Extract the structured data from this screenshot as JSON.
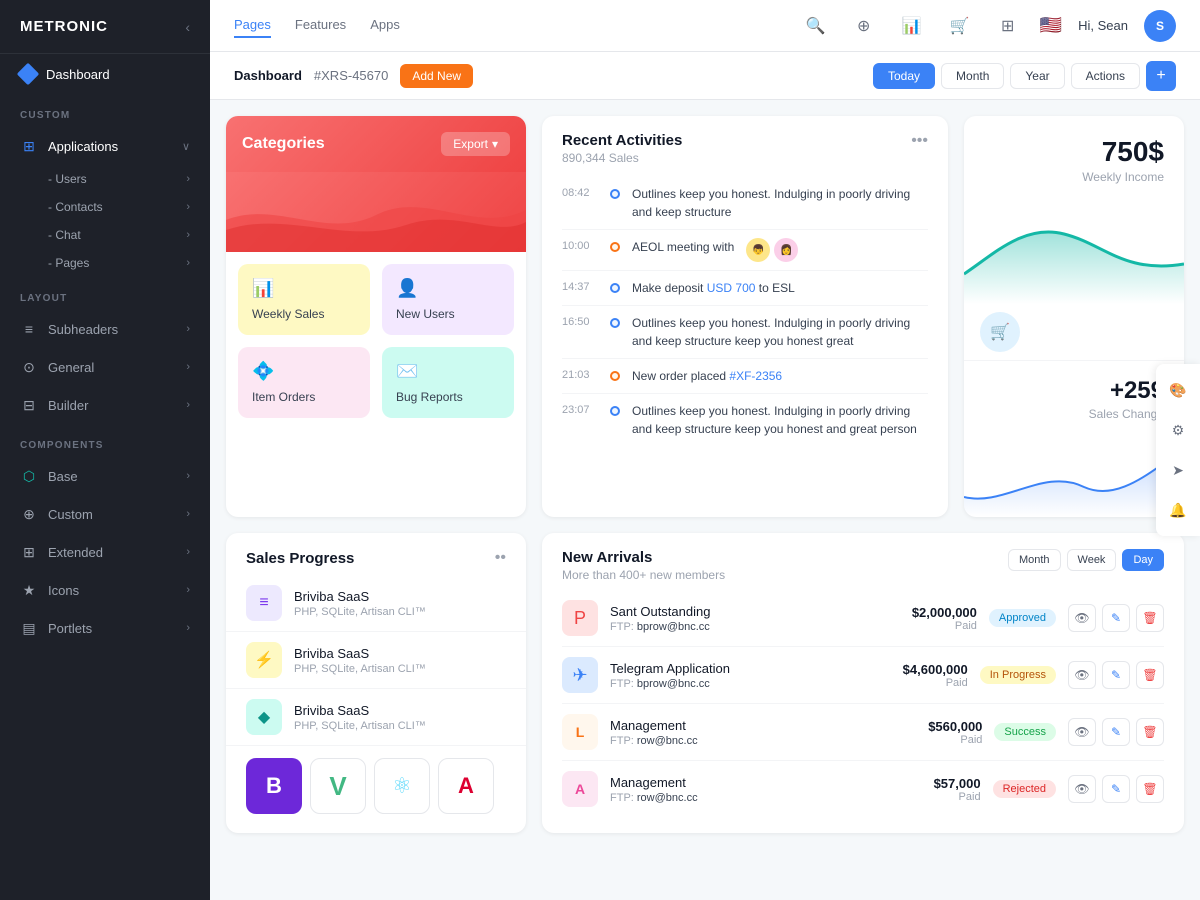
{
  "app": {
    "name": "METRONIC"
  },
  "topNav": {
    "tabs": [
      "Pages",
      "Features",
      "Apps"
    ],
    "activeTab": "Pages",
    "user": {
      "greeting": "Hi, Sean",
      "initials": "S"
    }
  },
  "breadcrumb": {
    "main": "Dashboard",
    "id": "#XRS-45670",
    "addNew": "Add New",
    "buttons": [
      "Today",
      "Month",
      "Year",
      "Actions"
    ]
  },
  "sidebar": {
    "logo": "METRONIC",
    "dashboard": "Dashboard",
    "sections": {
      "custom": "CUSTOM",
      "layout": "LAYOUT",
      "components": "COMPONENTS"
    },
    "customItems": [
      "Applications",
      "Users",
      "Contacts",
      "Chat",
      "Pages"
    ],
    "layoutItems": [
      "Subheaders",
      "General",
      "Builder"
    ],
    "componentItems": [
      "Base",
      "Custom",
      "Extended",
      "Icons",
      "Portlets"
    ]
  },
  "categories": {
    "title": "Categories",
    "exportLabel": "Export",
    "items": [
      {
        "label": "Weekly Sales",
        "icon": "📊",
        "color": "yellow"
      },
      {
        "label": "New Users",
        "icon": "👤+",
        "color": "purple"
      },
      {
        "label": "Item Orders",
        "icon": "💎",
        "color": "pink"
      },
      {
        "label": "Bug Reports",
        "icon": "✉️",
        "color": "teal"
      }
    ]
  },
  "recentActivities": {
    "title": "Recent Activities",
    "subtitle": "890,344 Sales",
    "items": [
      {
        "time": "08:42",
        "text": "Outlines keep you honest. Indulging in poorly driving and keep structure",
        "dotColor": "blue"
      },
      {
        "time": "10:00",
        "text": "AEOL meeting with",
        "dotColor": "orange",
        "hasAvatars": true
      },
      {
        "time": "14:37",
        "text": "Make deposit USD 700 to ESL",
        "dotColor": "blue",
        "highlight": "USD 700"
      },
      {
        "time": "16:50",
        "text": "Outlines keep you honest. Indulging in poorly driving and keep structure keep you honest great",
        "dotColor": "blue"
      },
      {
        "time": "21:03",
        "text": "New order placed #XF-2356",
        "dotColor": "orange",
        "highlight": "#XF-2356"
      },
      {
        "time": "23:07",
        "text": "Outlines keep you honest. Indulging in poorly driving and keep structure keep you honest and great person",
        "dotColor": "blue"
      }
    ]
  },
  "weeklyIncome": {
    "amount": "750$",
    "label": "Weekly Income",
    "change": "+259",
    "changeLabel": "Sales Change"
  },
  "salesProgress": {
    "title": "Sales Progress",
    "items": [
      {
        "name": "Briviba SaaS",
        "desc": "PHP, SQLite, Artisan CLI™",
        "iconColor": "purple",
        "icon": "≡"
      },
      {
        "name": "Briviba SaaS",
        "desc": "PHP, SQLite, Artisan CLI™",
        "iconColor": "yellow",
        "icon": "⚡"
      },
      {
        "name": "Briviba SaaS",
        "desc": "PHP, SQLite, Artisan CLI™",
        "iconColor": "teal",
        "icon": "◆"
      }
    ]
  },
  "newArrivals": {
    "title": "New Arrivals",
    "subtitle": "More than 400+ new members",
    "tabs": [
      "Month",
      "Week",
      "Day"
    ],
    "activeTab": "Day",
    "items": [
      {
        "name": "Sant Outstanding",
        "ftp": "bprow@bnc.cc",
        "amount": "$2,000,000",
        "paid": "Paid",
        "badge": "Approved",
        "badgeClass": "approved",
        "iconColor": "red",
        "icon": "P"
      },
      {
        "name": "Telegram Application",
        "ftp": "bprow@bnc.cc",
        "amount": "$4,600,000",
        "paid": "Paid",
        "badge": "In Progress",
        "badgeClass": "in-progress",
        "iconColor": "blue",
        "icon": "✈"
      },
      {
        "name": "Management",
        "ftp": "row@bnc.cc",
        "amount": "$560,000",
        "paid": "Paid",
        "badge": "Success",
        "badgeClass": "success",
        "iconColor": "orange",
        "icon": "L"
      },
      {
        "name": "Management",
        "ftp": "row@bnc.cc",
        "amount": "$57,000",
        "paid": "Paid",
        "badge": "Rejected",
        "badgeClass": "rejected",
        "iconColor": "pink",
        "icon": "A"
      }
    ]
  },
  "frameworks": [
    "B",
    "V",
    "⚛",
    "A"
  ]
}
